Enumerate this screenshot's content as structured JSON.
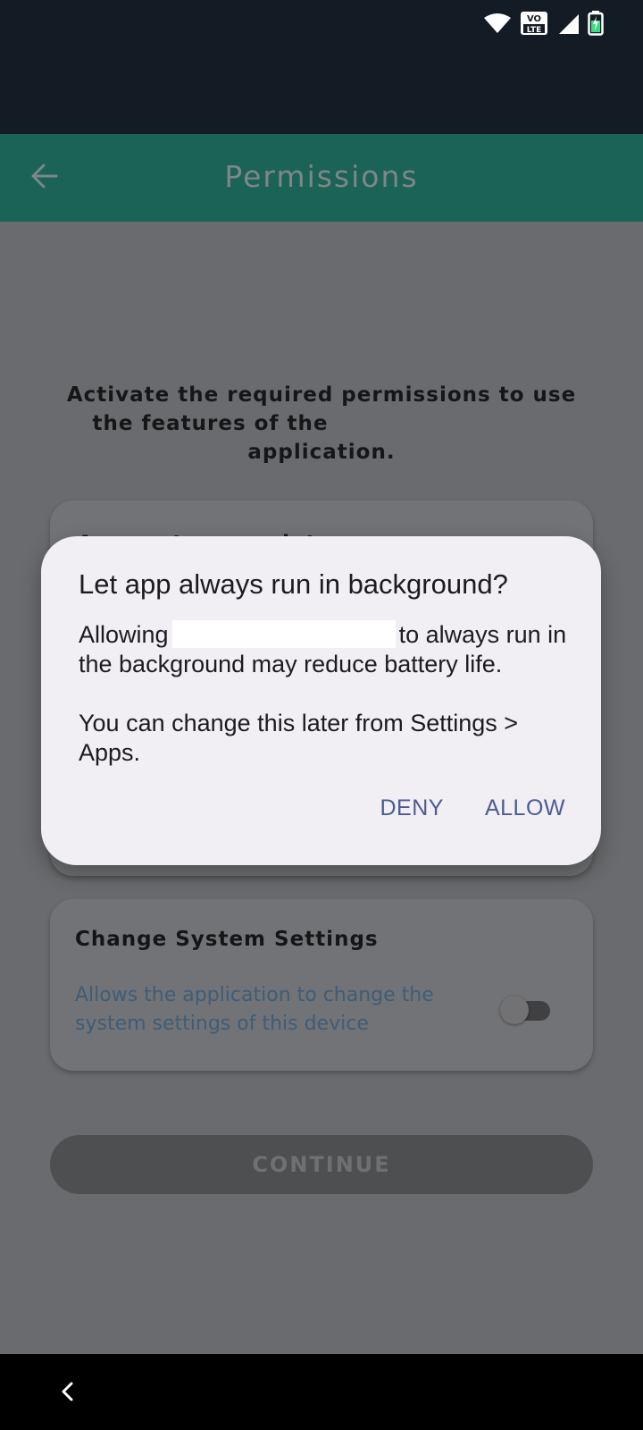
{
  "status_bar": {
    "icons": [
      "wifi-icon",
      "volte-icon",
      "signal-icon",
      "battery-charging-icon"
    ],
    "volte_top": "VO",
    "volte_bottom": "LTE"
  },
  "app_bar": {
    "title": "Permissions",
    "back_icon": "arrow-left-icon"
  },
  "main": {
    "intro_part1": "Activate the required permissions to use the features of the",
    "intro_part2": "application.",
    "card1_title": "Access to your data",
    "card2": {
      "title": "Change System Settings",
      "description": "Allows the application to change the system settings of this device",
      "toggle_on": false
    },
    "continue_label": "CONTINUE"
  },
  "dialog": {
    "title": "Let app always run in background?",
    "body_prefix": "Allowing",
    "body_suffix": "to always run in the background may reduce battery life.",
    "note": "You can change this later from Settings > Apps.",
    "deny_label": "DENY",
    "allow_label": "ALLOW"
  },
  "nav_bar": {
    "back_icon": "chevron-left-icon"
  },
  "colors": {
    "app_bar": "#1b6257",
    "scrim_background": "#6a6b6e",
    "dialog_surface": "#f1eff4",
    "dialog_action": "#4c5c92",
    "description_text": "#3e5d78"
  }
}
